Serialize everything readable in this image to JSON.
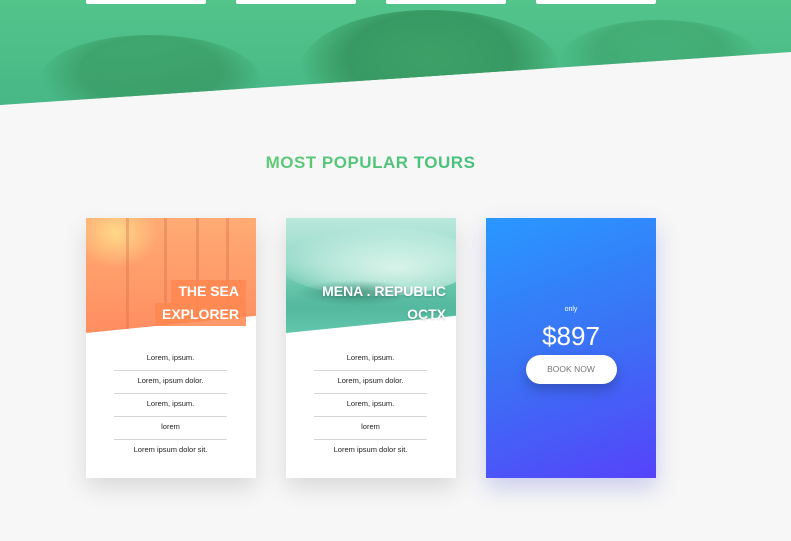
{
  "hero": {
    "nav_tab_count": 4
  },
  "section": {
    "title": "MOST POPULAR TOURS"
  },
  "cards": [
    {
      "heading_line1": "THE SEA",
      "heading_line2": "EXPLORER",
      "details": [
        "Lorem, ipsum.",
        "Lorem, ipsum dolor.",
        "Lorem, ipsum.",
        "lorem",
        "Lorem ipsum dolor sit."
      ]
    },
    {
      "heading_line1": "MENA . REPUBLIC",
      "heading_line2": "OCTX",
      "details": [
        "Lorem, ipsum.",
        "Lorem, ipsum dolor.",
        "Lorem, ipsum.",
        "lorem",
        "Lorem ipsum dolor sit."
      ]
    }
  ],
  "price_card": {
    "only_label": "only",
    "price": "$897",
    "button_label": "BOOK NOW"
  },
  "colors": {
    "title_gradient_start": "#7ed56f",
    "title_gradient_end": "#28b485",
    "price_card_gradient_start": "#2998ff",
    "price_card_gradient_end": "#5643fa",
    "hero_green": "#47b783"
  }
}
